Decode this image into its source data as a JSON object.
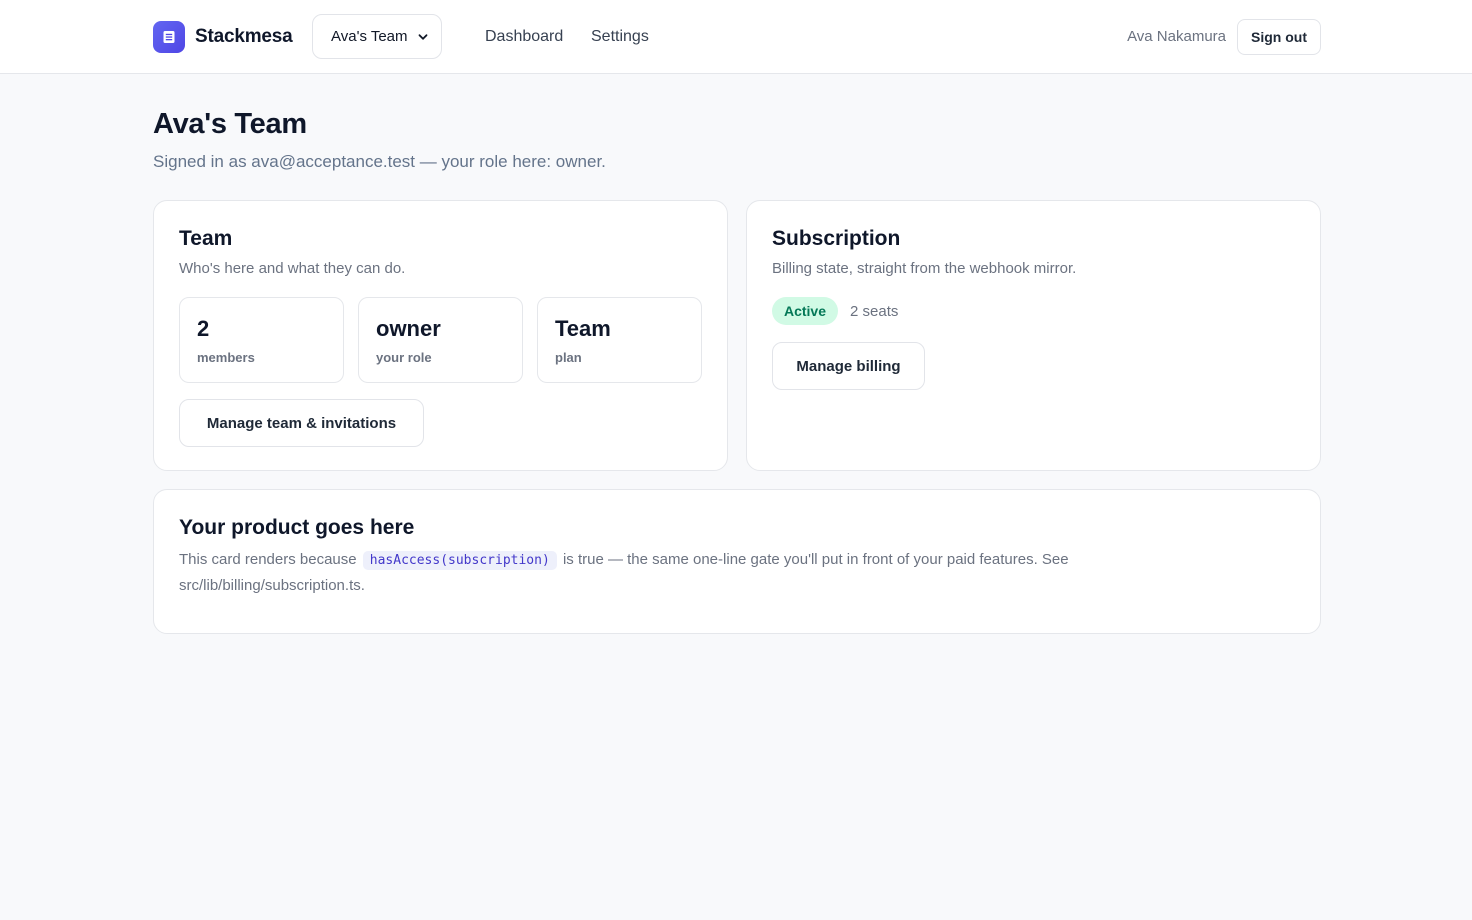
{
  "header": {
    "brand": "Stackmesa",
    "brand_icon": "document-icon",
    "team_select": {
      "selected": "Ava's Team"
    },
    "nav": [
      {
        "label": "Dashboard"
      },
      {
        "label": "Settings"
      }
    ],
    "user_name": "Ava Nakamura",
    "sign_out_label": "Sign out"
  },
  "page": {
    "title": "Ava's Team",
    "subtitle": "Signed in as ava@acceptance.test — your role here: owner."
  },
  "team_card": {
    "title": "Team",
    "subtitle": "Who's here and what they can do.",
    "stats": [
      {
        "value": "2",
        "label": "members"
      },
      {
        "value": "owner",
        "label": "your role"
      },
      {
        "value": "Team",
        "label": "plan"
      }
    ],
    "manage_label": "Manage team & invitations"
  },
  "subscription_card": {
    "title": "Subscription",
    "subtitle": "Billing state, straight from the webhook mirror.",
    "status": "Active",
    "status_color": "#047857",
    "seats": "2 seats",
    "manage_label": "Manage billing"
  },
  "product_card": {
    "title": "Your product goes here",
    "text_before": "This card renders because",
    "code": "hasAccess(subscription)",
    "text_after": "is true — the same one-line gate you'll put in front of your paid features. See src/lib/billing/subscription.ts."
  },
  "colors": {
    "accent": "#4f46e5",
    "background": "#f8f9fb"
  }
}
